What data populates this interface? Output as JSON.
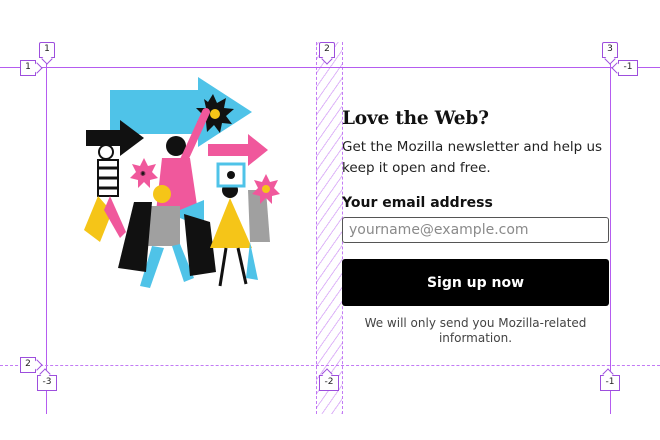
{
  "newsletter": {
    "title": "Love the Web?",
    "description": "Get the Mozilla newsletter and help us keep it open and free.",
    "email_label": "Your email address",
    "email_value": "",
    "email_placeholder": "yourname@example.com",
    "submit_label": "Sign up now",
    "privacy_note": "We will only send you Mozilla-related information."
  },
  "grid_overlay": {
    "column_top": [
      "1",
      "2",
      "3"
    ],
    "column_bottom": [
      "-3",
      "-2",
      "-1"
    ],
    "row_left": [
      "1",
      "2"
    ],
    "row_right": [
      "-1"
    ],
    "line_color": "#b55cf0"
  },
  "illustration": {
    "icon": "protest-crowd-illustration",
    "colors": [
      "#4fc3e8",
      "#f0589c",
      "#f5c518",
      "#111111",
      "#a0a0a0"
    ]
  }
}
